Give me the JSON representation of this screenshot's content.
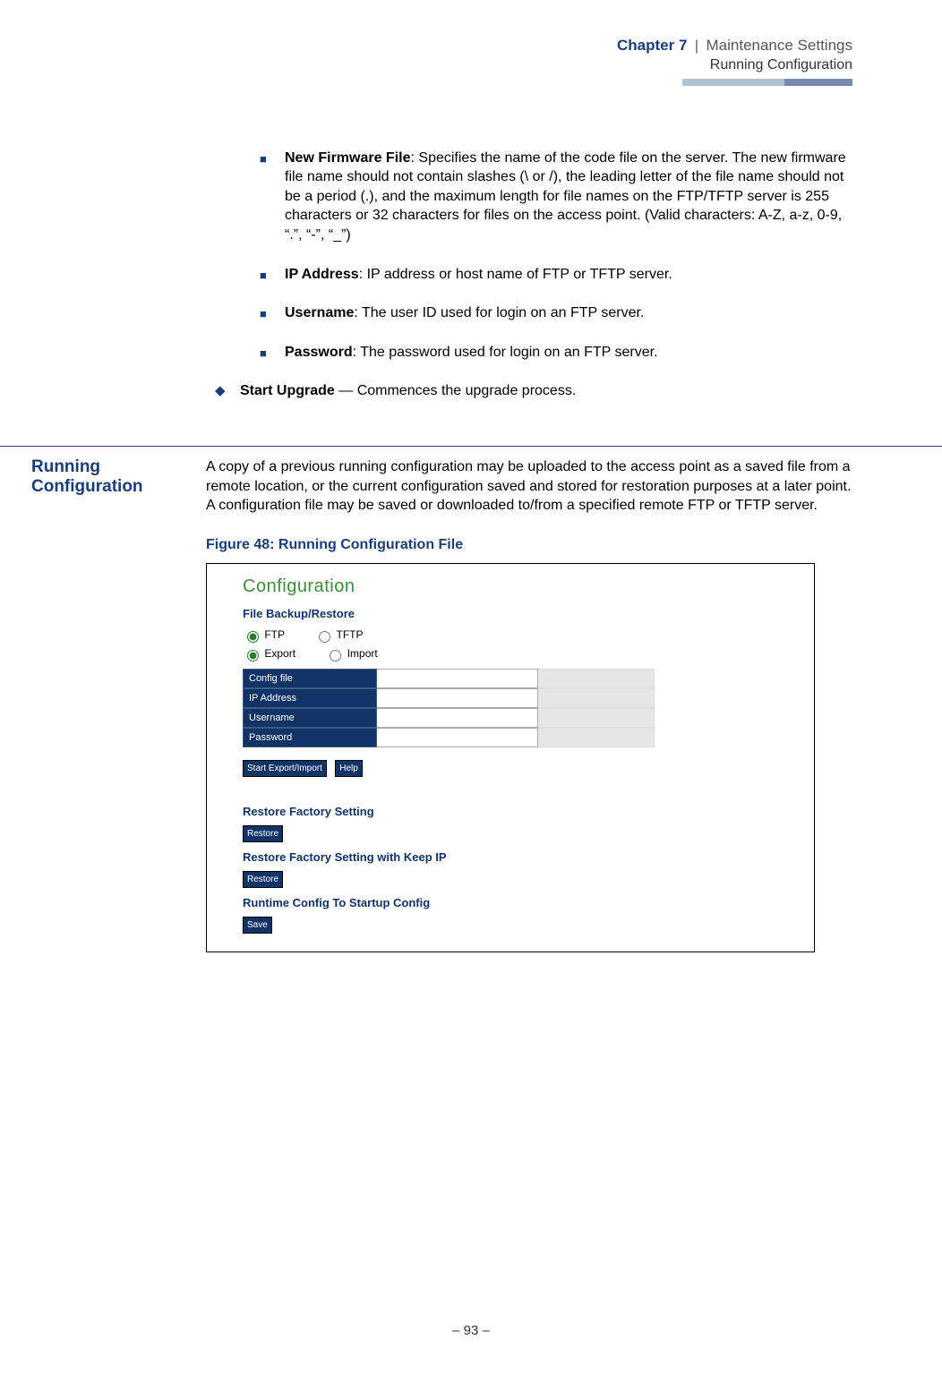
{
  "header": {
    "chapter": "Chapter 7",
    "pipe": "|",
    "section": "Maintenance Settings",
    "subsection": "Running Configuration"
  },
  "bullets": {
    "new_firmware_title": "New Firmware File",
    "new_firmware_text": ": Specifies the name of the code file on the server. The new firmware file name should not contain slashes (\\ or /), the leading letter of the file name should not be a period (.), and the maximum length for file names on the FTP/TFTP server is 255 characters or 32 characters for files on the access point. (Valid characters: A-Z, a-z, 0-9, “.”, “-”, “_”)",
    "ip_title": "IP Address",
    "ip_text": ": IP address or host name of FTP or TFTP server.",
    "user_title": "Username",
    "user_text": ": The user ID used for login on an FTP server.",
    "pass_title": "Password",
    "pass_text": ": The password used for login on an FTP server.",
    "start_title": "Start Upgrade",
    "start_text": " — Commences the upgrade process."
  },
  "section": {
    "heading": "Running Configuration",
    "body": "A copy of a previous running configuration may be uploaded to the access point as a saved file from a remote location, or the current configuration saved and stored for restoration purposes at a later point. A configuration file may be saved or downloaded to/from a specified remote FTP or TFTP server.",
    "figure_caption": "Figure 48:  Running Configuration File"
  },
  "screenshot": {
    "title": "Configuration",
    "subhead": "File Backup/Restore",
    "radio_ftp": "FTP",
    "radio_tftp": "TFTP",
    "radio_export": "Export",
    "radio_import": "Import",
    "field_config": "Config file",
    "field_ip": "IP Address",
    "field_user": "Username",
    "field_pass": "Password",
    "btn_start": "Start Export/Import",
    "btn_help": "Help",
    "restore_factory": "Restore Factory Setting",
    "btn_restore1": "Restore",
    "restore_keepip": "Restore Factory Setting with Keep IP",
    "btn_restore2": "Restore",
    "runtime": "Runtime Config To Startup Config",
    "btn_save": "Save"
  },
  "footer": {
    "page": "–  93  –"
  }
}
